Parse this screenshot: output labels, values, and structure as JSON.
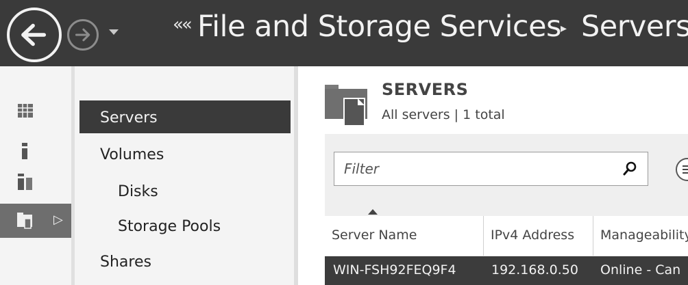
{
  "window": {
    "breadcrumb_sep": "««",
    "breadcrumb_parent": "File and Storage Services",
    "breadcrumb_arrow": "▸",
    "breadcrumb_current": "Servers"
  },
  "nav_icons": [
    "back-icon",
    "forward-icon",
    "dropdown-icon"
  ],
  "rail": {
    "items": [
      "dashboard-icon",
      "local-server-icon",
      "all-servers-icon",
      "file-storage-icon"
    ],
    "active_index": 3,
    "expand_arrow": "▷"
  },
  "nav_pane": {
    "items": [
      {
        "label": "Servers",
        "selected": true
      },
      {
        "label": "Volumes",
        "selected": false
      },
      {
        "label": "Disks",
        "selected": false
      },
      {
        "label": "Storage Pools",
        "selected": false
      },
      {
        "label": "Shares",
        "selected": false
      }
    ]
  },
  "tile": {
    "title": "SERVERS",
    "subtitle": "All servers | 1 total"
  },
  "filter": {
    "placeholder": "Filter"
  },
  "table": {
    "columns": [
      "Server Name",
      "IPv4 Address",
      "Manageability"
    ],
    "sorted_column": "Server Name",
    "rows": [
      {
        "server_name": "WIN-FSH92FEQ9F4",
        "ipv4": "192.168.0.50",
        "manageability": "Online - Can"
      }
    ]
  },
  "colors": {
    "titlebar": "#3a3a3a",
    "selection": "#3a3a3a",
    "pane_bg": "#f4f4f4",
    "panel_bg": "#efefef"
  }
}
